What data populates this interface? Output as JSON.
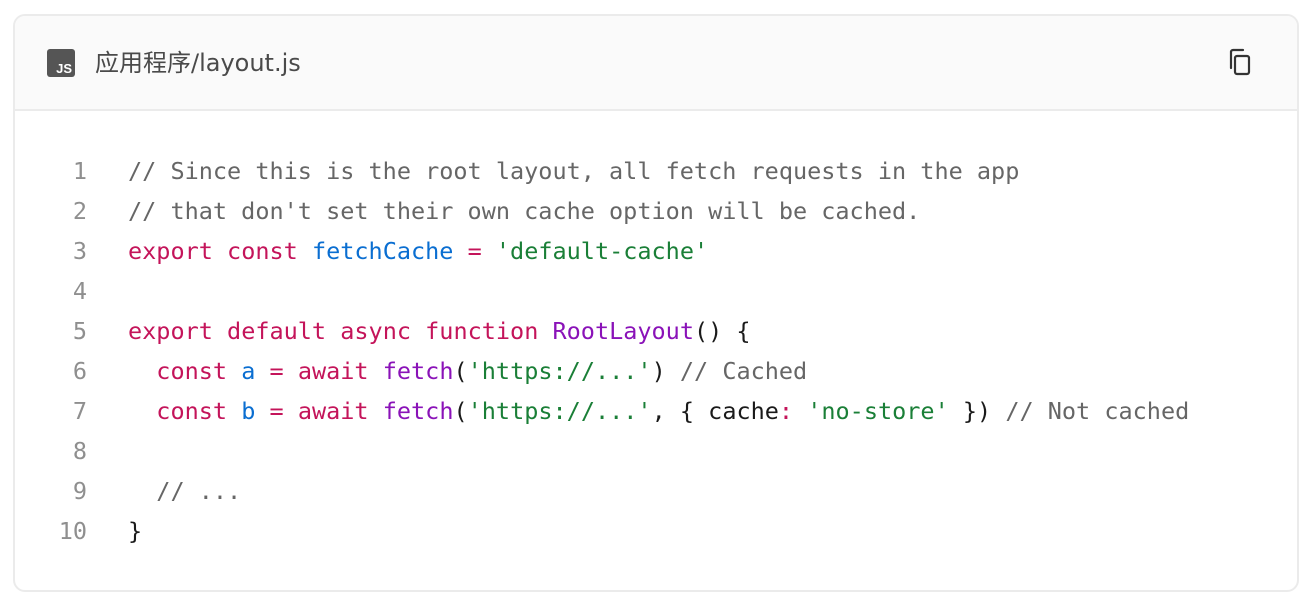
{
  "header": {
    "file_badge": "JS",
    "filename": "应用程序/layout.js",
    "copy_icon": "copy-icon"
  },
  "code": {
    "language": "javascript",
    "lines": [
      {
        "number": "1",
        "tokens": [
          {
            "t": "comment",
            "v": "// Since this is the root layout, all fetch requests in the app"
          }
        ]
      },
      {
        "number": "2",
        "tokens": [
          {
            "t": "comment",
            "v": "// that don't set their own cache option will be cached."
          }
        ]
      },
      {
        "number": "3",
        "tokens": [
          {
            "t": "keyword",
            "v": "export"
          },
          {
            "t": "punct",
            "v": " "
          },
          {
            "t": "keyword",
            "v": "const"
          },
          {
            "t": "punct",
            "v": " "
          },
          {
            "t": "var",
            "v": "fetchCache"
          },
          {
            "t": "punct",
            "v": " "
          },
          {
            "t": "keyword",
            "v": "="
          },
          {
            "t": "punct",
            "v": " "
          },
          {
            "t": "string",
            "v": "'default-cache'"
          }
        ]
      },
      {
        "number": "4",
        "tokens": []
      },
      {
        "number": "5",
        "tokens": [
          {
            "t": "keyword",
            "v": "export"
          },
          {
            "t": "punct",
            "v": " "
          },
          {
            "t": "keyword",
            "v": "default"
          },
          {
            "t": "punct",
            "v": " "
          },
          {
            "t": "keyword",
            "v": "async"
          },
          {
            "t": "punct",
            "v": " "
          },
          {
            "t": "keyword",
            "v": "function"
          },
          {
            "t": "punct",
            "v": " "
          },
          {
            "t": "func",
            "v": "RootLayout"
          },
          {
            "t": "punct",
            "v": "() {"
          }
        ]
      },
      {
        "number": "6",
        "tokens": [
          {
            "t": "punct",
            "v": "  "
          },
          {
            "t": "keyword",
            "v": "const"
          },
          {
            "t": "punct",
            "v": " "
          },
          {
            "t": "var",
            "v": "a"
          },
          {
            "t": "punct",
            "v": " "
          },
          {
            "t": "keyword",
            "v": "="
          },
          {
            "t": "punct",
            "v": " "
          },
          {
            "t": "keyword",
            "v": "await"
          },
          {
            "t": "punct",
            "v": " "
          },
          {
            "t": "func",
            "v": "fetch"
          },
          {
            "t": "punct",
            "v": "("
          },
          {
            "t": "string",
            "v": "'https://...'"
          },
          {
            "t": "punct",
            "v": ") "
          },
          {
            "t": "comment",
            "v": "// Cached"
          }
        ]
      },
      {
        "number": "7",
        "tokens": [
          {
            "t": "punct",
            "v": "  "
          },
          {
            "t": "keyword",
            "v": "const"
          },
          {
            "t": "punct",
            "v": " "
          },
          {
            "t": "var",
            "v": "b"
          },
          {
            "t": "punct",
            "v": " "
          },
          {
            "t": "keyword",
            "v": "="
          },
          {
            "t": "punct",
            "v": " "
          },
          {
            "t": "keyword",
            "v": "await"
          },
          {
            "t": "punct",
            "v": " "
          },
          {
            "t": "func",
            "v": "fetch"
          },
          {
            "t": "punct",
            "v": "("
          },
          {
            "t": "string",
            "v": "'https://...'"
          },
          {
            "t": "punct",
            "v": ", { cache"
          },
          {
            "t": "keyword",
            "v": ":"
          },
          {
            "t": "punct",
            "v": " "
          },
          {
            "t": "string",
            "v": "'no-store'"
          },
          {
            "t": "punct",
            "v": " }) "
          },
          {
            "t": "comment",
            "v": "// Not cached"
          }
        ]
      },
      {
        "number": "8",
        "tokens": []
      },
      {
        "number": "9",
        "tokens": [
          {
            "t": "punct",
            "v": "  "
          },
          {
            "t": "comment",
            "v": "// ..."
          }
        ]
      },
      {
        "number": "10",
        "tokens": [
          {
            "t": "punct",
            "v": "}"
          }
        ]
      }
    ]
  }
}
